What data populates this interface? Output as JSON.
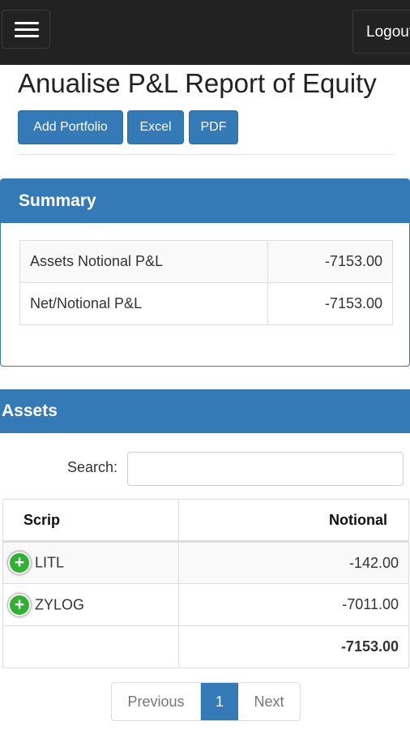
{
  "nav": {
    "logout_label": "Logout"
  },
  "page": {
    "title": "Anualise P&L Report of Equity"
  },
  "toolbar": {
    "add_portfolio_label": "Add Portfolio",
    "excel_label": "Excel",
    "pdf_label": "PDF"
  },
  "summary": {
    "title": "Summary",
    "rows": [
      {
        "label": "Assets Notional P&L",
        "value": "-7153.00"
      },
      {
        "label": "Net/Notional P&L",
        "value": "-7153.00"
      }
    ]
  },
  "assets": {
    "title": "Assets",
    "search_label": "Search:",
    "search_value": "",
    "columns": [
      "Scrip",
      "Notional"
    ],
    "rows": [
      {
        "scrip": "LITL",
        "notional": "-142.00"
      },
      {
        "scrip": "ZYLOG",
        "notional": "-7011.00"
      }
    ],
    "total": "-7153.00"
  },
  "pagination": {
    "previous_label": "Previous",
    "current_page": "1",
    "next_label": "Next"
  },
  "colors": {
    "primary": "#337ab7",
    "navbar": "#222222",
    "expand_icon": "#31b131"
  },
  "icons": {
    "menu": "hamburger-icon",
    "expand": "plus-circle-icon"
  }
}
